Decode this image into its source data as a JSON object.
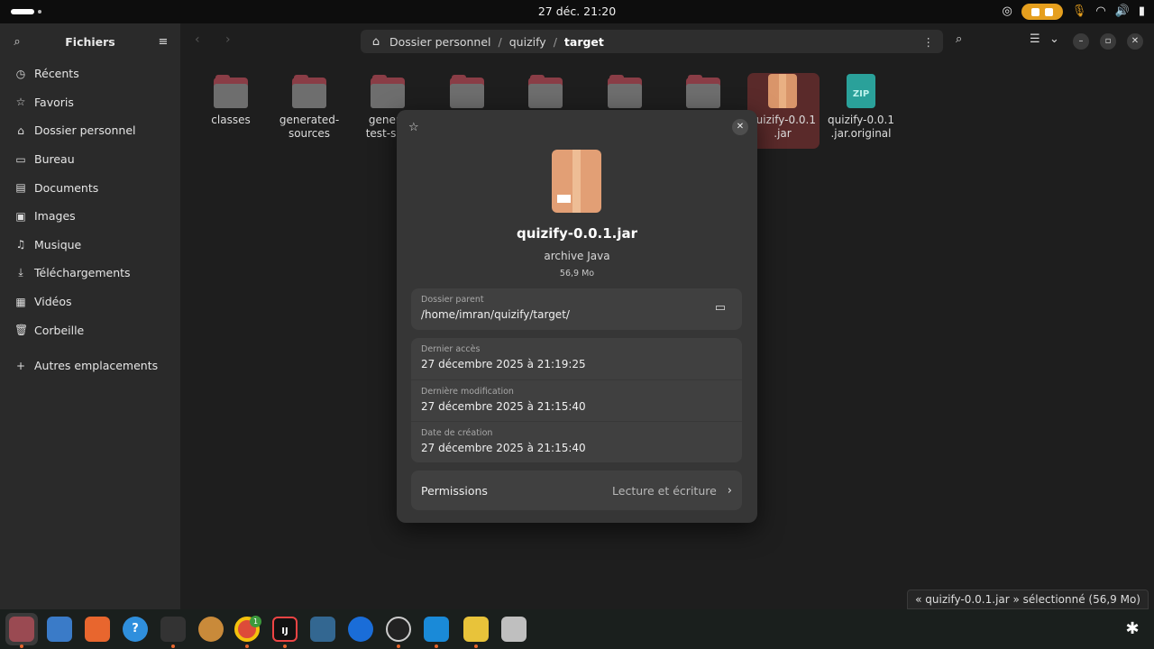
{
  "topbar": {
    "clock": "27 déc.  21:20",
    "tray_icons": [
      "chrome-tray-icon",
      "screen-share-icon",
      "stop-icon",
      "microphone-icon",
      "wifi-icon",
      "volume-icon",
      "battery-icon"
    ]
  },
  "sidebar": {
    "title": "Fichiers",
    "items": [
      {
        "label": "Récents",
        "icon": "clock-icon"
      },
      {
        "label": "Favoris",
        "icon": "star-icon"
      },
      {
        "label": "Dossier personnel",
        "icon": "home-icon"
      },
      {
        "label": "Bureau",
        "icon": "desktop-icon"
      },
      {
        "label": "Documents",
        "icon": "document-icon"
      },
      {
        "label": "Images",
        "icon": "image-icon"
      },
      {
        "label": "Musique",
        "icon": "music-icon"
      },
      {
        "label": "Téléchargements",
        "icon": "download-icon"
      },
      {
        "label": "Vidéos",
        "icon": "video-icon"
      },
      {
        "label": "Corbeille",
        "icon": "trash-icon"
      }
    ],
    "other": {
      "label": "Autres emplacements",
      "icon": "plus-icon"
    }
  },
  "path": {
    "crumbs": [
      "Dossier personnel",
      "quizify",
      "target"
    ]
  },
  "files": [
    {
      "line1": "classes",
      "line2": ""
    },
    {
      "line1": "generated-",
      "line2": "sources"
    },
    {
      "line1": "genera",
      "line2": "test-sou"
    },
    {
      "line1": "",
      "line2": ""
    },
    {
      "line1": "",
      "line2": ""
    },
    {
      "line1": "",
      "line2": ""
    },
    {
      "line1": "",
      "line2": ""
    },
    {
      "line1": "quizify-0.0.1",
      "line2": ".jar"
    },
    {
      "line1": "quizify-0.0.1",
      "line2": ".jar.original"
    }
  ],
  "zip_label": "ZIP",
  "dialog": {
    "filename": "quizify-0.0.1.jar",
    "type": "archive Java",
    "size": "56,9 Mo",
    "parent_label": "Dossier parent",
    "parent_value": "/home/imran/quizify/target/",
    "accessed_label": "Dernier accès",
    "accessed_value": "27 décembre 2025 à 21:19:25",
    "modified_label": "Dernière modification",
    "modified_value": "27 décembre 2025 à 21:15:40",
    "created_label": "Date de création",
    "created_value": "27 décembre 2025 à 21:15:40",
    "permissions_label": "Permissions",
    "permissions_value": "Lecture et écriture"
  },
  "status": "« quizify-0.0.1.jar » sélectionné  (56,9 Mo)",
  "dock": {
    "apps": [
      "files-app-icon",
      "text-editor-icon",
      "app-center-icon",
      "help-icon",
      "terminal-icon",
      "dog-app-icon",
      "chrome-icon",
      "intellij-icon",
      "postgres-icon",
      "password-manager-icon",
      "obs-icon",
      "vscode-icon",
      "notes-icon",
      "trash-dock-icon"
    ],
    "chrome_badge": "1",
    "intellij_label": "IJ"
  }
}
